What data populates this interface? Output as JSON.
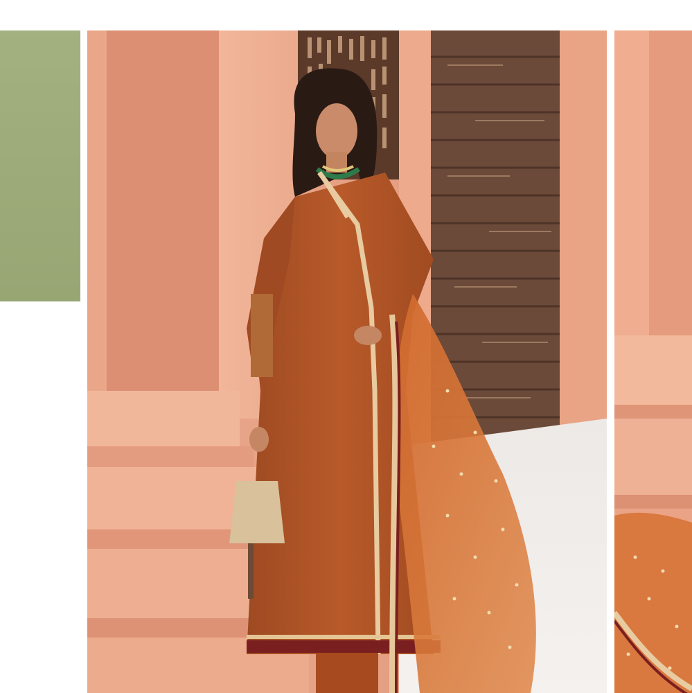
{
  "gallery": {
    "zoom_button": {
      "icon": "search-icon"
    }
  }
}
